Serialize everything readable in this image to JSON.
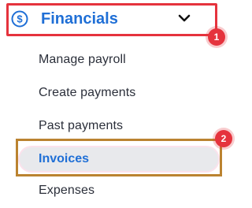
{
  "header": {
    "title": "Financials",
    "icon": "dollar-circle-icon",
    "toggle_icon": "chevron-down-icon",
    "accent_color": "#1f6fd6"
  },
  "annotations": {
    "badge_1": "1",
    "badge_2": "2",
    "marker_color": "#e5333d"
  },
  "menu": {
    "items": [
      {
        "label": "Manage payroll"
      },
      {
        "label": "Create payments"
      },
      {
        "label": "Past payments"
      },
      {
        "label": "Invoices",
        "selected": true
      },
      {
        "label": "Expenses"
      }
    ]
  }
}
